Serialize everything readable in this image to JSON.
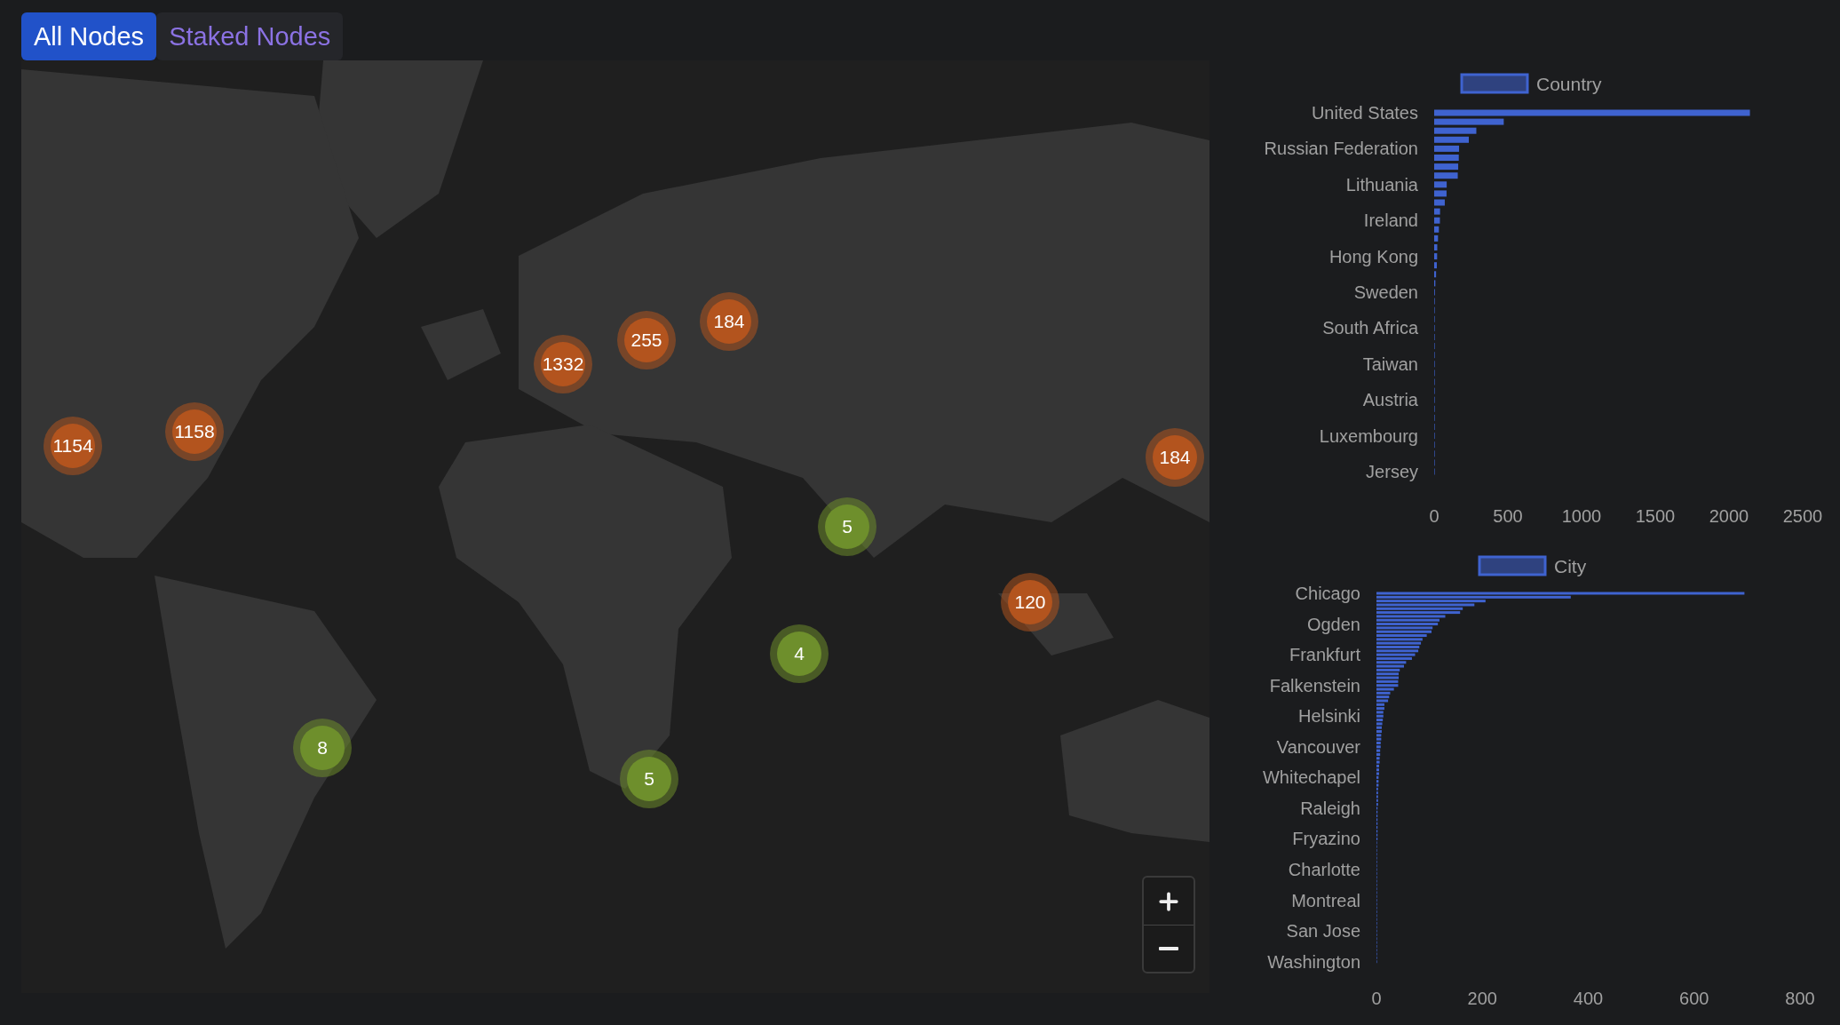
{
  "tabs": [
    {
      "label": "All Nodes",
      "selected": true
    },
    {
      "label": "Staked Nodes",
      "selected": false
    }
  ],
  "map": {
    "kind": "picture",
    "clusters": [
      {
        "count": "1154",
        "color": "#b3541e"
      },
      {
        "count": "1158",
        "color": "#b3541e"
      },
      {
        "count": "1332",
        "color": "#b3541e"
      },
      {
        "count": "255",
        "color": "#b3541e"
      },
      {
        "count": "184",
        "color": "#b3541e"
      },
      {
        "count": "184",
        "color": "#b3541e"
      },
      {
        "count": "5",
        "color": "#6e8f2c"
      },
      {
        "count": "120",
        "color": "#b3541e"
      },
      {
        "count": "4",
        "color": "#6e8f2c"
      },
      {
        "count": "8",
        "color": "#6e8f2c"
      },
      {
        "count": "5",
        "color": "#6e8f2c"
      }
    ]
  },
  "charts": [
    {
      "chart_data": {
        "type": "bar",
        "orientation": "horizontal",
        "categories": [
          "United States",
          null,
          null,
          null,
          "Russian Federation",
          null,
          null,
          null,
          "Lithuania",
          null,
          null,
          null,
          "Ireland",
          null,
          null,
          null,
          "Hong Kong",
          null,
          null,
          null,
          "Sweden",
          null,
          null,
          null,
          "South Africa",
          null,
          null,
          null,
          "Taiwan",
          null,
          null,
          null,
          "Austria",
          null,
          null,
          null,
          "Luxembourg",
          null,
          null,
          null,
          "Jersey"
        ],
        "series": [
          {
            "name": "Country",
            "color": "#3f63d0",
            "values": [
              2142,
              472,
              286,
              235,
              169,
              167,
              163,
              160,
              85,
              84,
              72,
              40,
              39,
              32,
              26,
              21,
              20,
              18,
              13,
              8,
              5,
              4,
              3,
              3,
              3,
              2,
              2,
              2,
              2,
              2,
              2,
              1,
              1,
              1,
              1,
              1,
              1,
              1,
              1,
              1,
              1
            ]
          }
        ],
        "xlim": [
          0,
          2500
        ],
        "xticks": [
          0,
          500,
          1000,
          1500,
          2000,
          2500
        ]
      }
    },
    {
      "chart_data": {
        "type": "bar",
        "orientation": "horizontal",
        "categories": [
          "Chicago",
          null,
          null,
          null,
          null,
          null,
          null,
          null,
          "Ogden",
          null,
          null,
          null,
          null,
          null,
          null,
          null,
          "Frankfurt",
          null,
          null,
          null,
          null,
          null,
          null,
          null,
          "Falkenstein",
          null,
          null,
          null,
          null,
          null,
          null,
          null,
          "Helsinki",
          null,
          null,
          null,
          null,
          null,
          null,
          null,
          "Vancouver",
          null,
          null,
          null,
          null,
          null,
          null,
          null,
          "Whitechapel",
          null,
          null,
          null,
          null,
          null,
          null,
          null,
          "Raleigh",
          null,
          null,
          null,
          null,
          null,
          null,
          null,
          "Fryazino",
          null,
          null,
          null,
          null,
          null,
          null,
          null,
          "Charlotte",
          null,
          null,
          null,
          null,
          null,
          null,
          null,
          "Montreal",
          null,
          null,
          null,
          null,
          null,
          null,
          null,
          "San Jose",
          null,
          null,
          null,
          null,
          null,
          null,
          null,
          "Washington"
        ],
        "series": [
          {
            "name": "City",
            "color": "#3f63d0",
            "values": [
              695,
              367,
              206,
              185,
              163,
              158,
              130,
              119,
              116,
              106,
              104,
              95,
              87,
              84,
              81,
              79,
              73,
              67,
              56,
              52,
              44,
              42,
              42,
              41,
              41,
              33,
              26,
              24,
              22,
              15,
              15,
              13,
              13,
              12,
              11,
              10,
              10,
              9,
              9,
              8,
              8,
              7,
              7,
              6,
              6,
              5,
              5,
              5,
              4,
              4,
              4,
              3,
              3,
              3,
              3,
              3,
              2,
              2,
              2,
              2,
              2,
              2,
              2,
              2,
              2,
              1,
              1,
              1,
              1,
              1,
              1,
              1,
              1,
              1,
              1,
              1,
              1,
              1,
              1,
              1,
              1,
              1,
              1,
              1,
              1,
              1,
              1,
              1,
              1,
              1,
              1,
              1,
              1,
              1,
              1,
              1,
              1
            ]
          }
        ],
        "xlim": [
          0,
          800
        ],
        "xticks": [
          0,
          200,
          400,
          600,
          800
        ]
      }
    }
  ]
}
